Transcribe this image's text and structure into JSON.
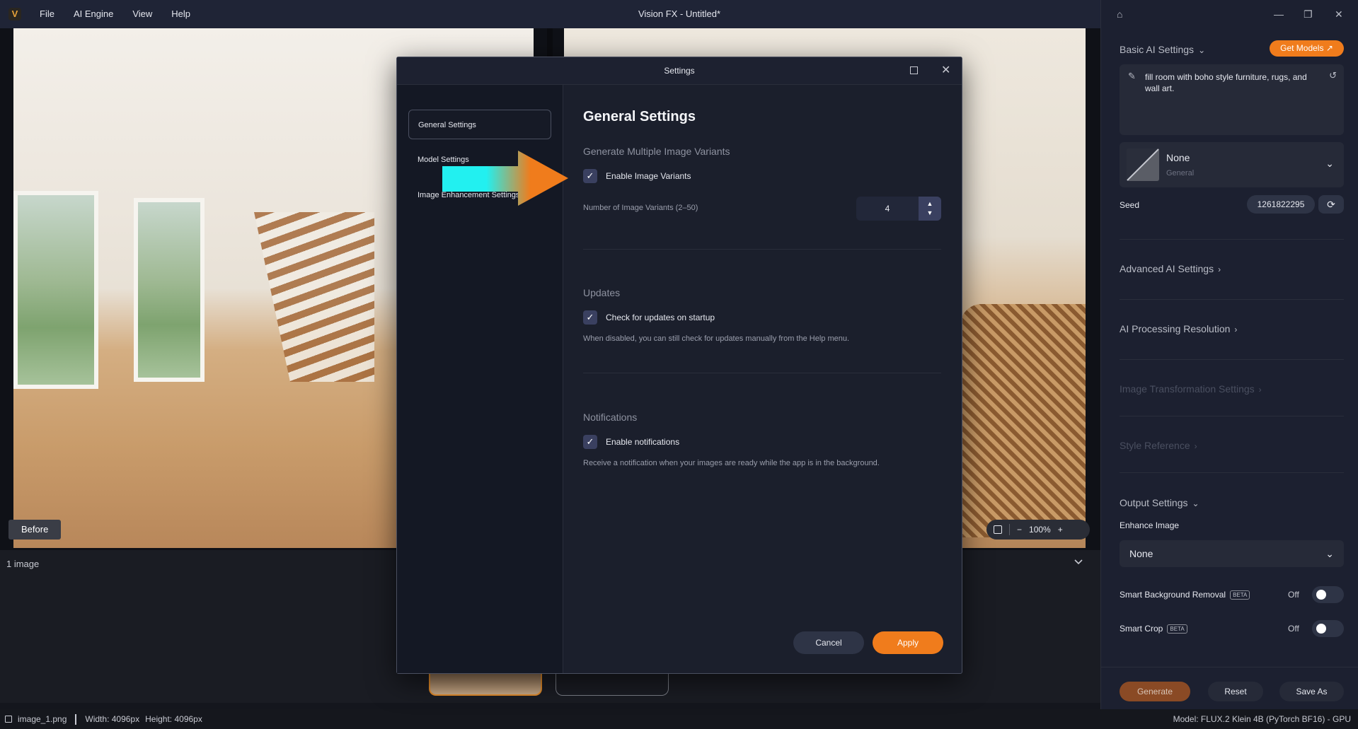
{
  "window": {
    "title": "Vision FX - Untitled*",
    "logo_letter": "V"
  },
  "menu": [
    "File",
    "AI Engine",
    "View",
    "Help"
  ],
  "canvas": {
    "before_label": "Before",
    "zoom": "100%",
    "zoom_out": "−",
    "zoom_in": "+"
  },
  "filmstrip": {
    "count_label": "1 image"
  },
  "status": {
    "file": "image_1.png",
    "width": "Width: 4096px",
    "height": "Height: 4096px",
    "model": "Model: FLUX.2 Klein 4B (PyTorch BF16) - GPU"
  },
  "right_panel": {
    "basic_title": "Basic AI Settings",
    "get_models": "Get Models",
    "prompt": "fill room with boho style furniture, rugs, and wall art.",
    "model_name": "None",
    "model_category": "General",
    "seed_label": "Seed",
    "seed_value": "1261822295",
    "advanced_title": "Advanced AI Settings",
    "processing_title": "AI Processing Resolution",
    "transformation_title": "Image Transformation Settings",
    "style_title": "Style Reference",
    "output_title": "Output Settings",
    "enhance_label": "Enhance Image",
    "enhance_value": "None",
    "bg_removal_label": "Smart Background Removal",
    "bg_removal_state": "Off",
    "smart_crop_label": "Smart Crop",
    "smart_crop_state": "Off",
    "beta": "BETA",
    "generate": "Generate",
    "reset": "Reset",
    "save_as": "Save As"
  },
  "dialog": {
    "title": "Settings",
    "nav": [
      "General Settings",
      "Model Settings",
      "Image Enhancement Settings"
    ],
    "active_nav": "General Settings",
    "heading": "General Settings",
    "variants_group": "Generate Multiple Image Variants",
    "enable_variants": "Enable Image Variants",
    "enable_variants_checked": true,
    "variants_count_label": "Number of Image Variants (2–50)",
    "variants_count": "4",
    "updates_group": "Updates",
    "check_updates": "Check for updates on startup",
    "check_updates_checked": true,
    "updates_help": "When disabled, you can still check for updates manually from the Help menu.",
    "notifications_group": "Notifications",
    "enable_notifications": "Enable notifications",
    "enable_notifications_checked": true,
    "notifications_help": "Receive a notification when your images are ready while the app is in the background.",
    "cancel": "Cancel",
    "apply": "Apply"
  },
  "colors": {
    "accent": "#f07c1c",
    "panel_bg": "#1c2030",
    "dialog_bg": "#1b1f2c",
    "annotation_arrow_start": "#22f0f0",
    "annotation_arrow_end": "#f07c1c"
  }
}
